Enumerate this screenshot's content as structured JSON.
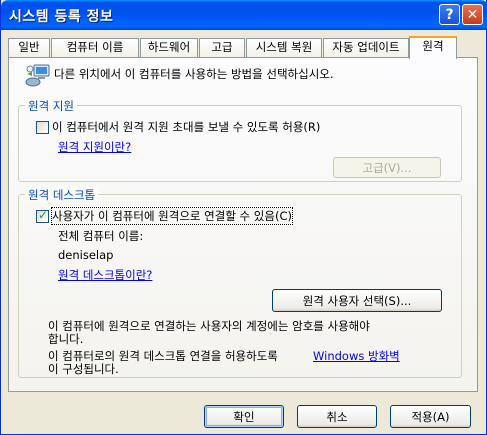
{
  "window": {
    "title": "시스템 등록 정보"
  },
  "titlebar": {
    "help": "?",
    "close": "✕"
  },
  "tabs": [
    {
      "label": "일반"
    },
    {
      "label": "컴퓨터 이름"
    },
    {
      "label": "하드웨어"
    },
    {
      "label": "고급"
    },
    {
      "label": "시스템 복원"
    },
    {
      "label": "자동 업데이트"
    },
    {
      "label": "원격"
    }
  ],
  "intro": "다른 위치에서 이 컴퓨터를 사용하는 방법을 선택하십시오.",
  "remote_assistance": {
    "group_label": "원격 지원",
    "checkbox_label": "이 컴퓨터에서 원격 지원 초대를 보낼 수 있도록 허용(R)",
    "checked": false,
    "link": "원격 지원이란?",
    "advanced_button": "고급(V)..."
  },
  "remote_desktop": {
    "group_label": "원격 데스크톱",
    "checkbox_label": "사용자가 이 컴퓨터에 원격으로 연결할 수 있음(C)",
    "checked": true,
    "computer_name_label": "전체 컴퓨터 이름:",
    "computer_name": "deniselap",
    "link": "원격 데스크톱이란?",
    "select_users_button": "원격 사용자 선택(S)...",
    "note1_line1": "이 컴퓨터에 원격으로 연결하는 사용자의 계정에는 암호를 사용해야",
    "note1_line2": "합니다.",
    "note2_line1": "이 컴퓨터로의 원격 데스크톱 연결을 허용하도록",
    "note2_link": "Windows 방화벽",
    "note2_line2": "이 구성됩니다."
  },
  "buttons": {
    "ok": "확인",
    "cancel": "취소",
    "apply": "적용(A)"
  }
}
